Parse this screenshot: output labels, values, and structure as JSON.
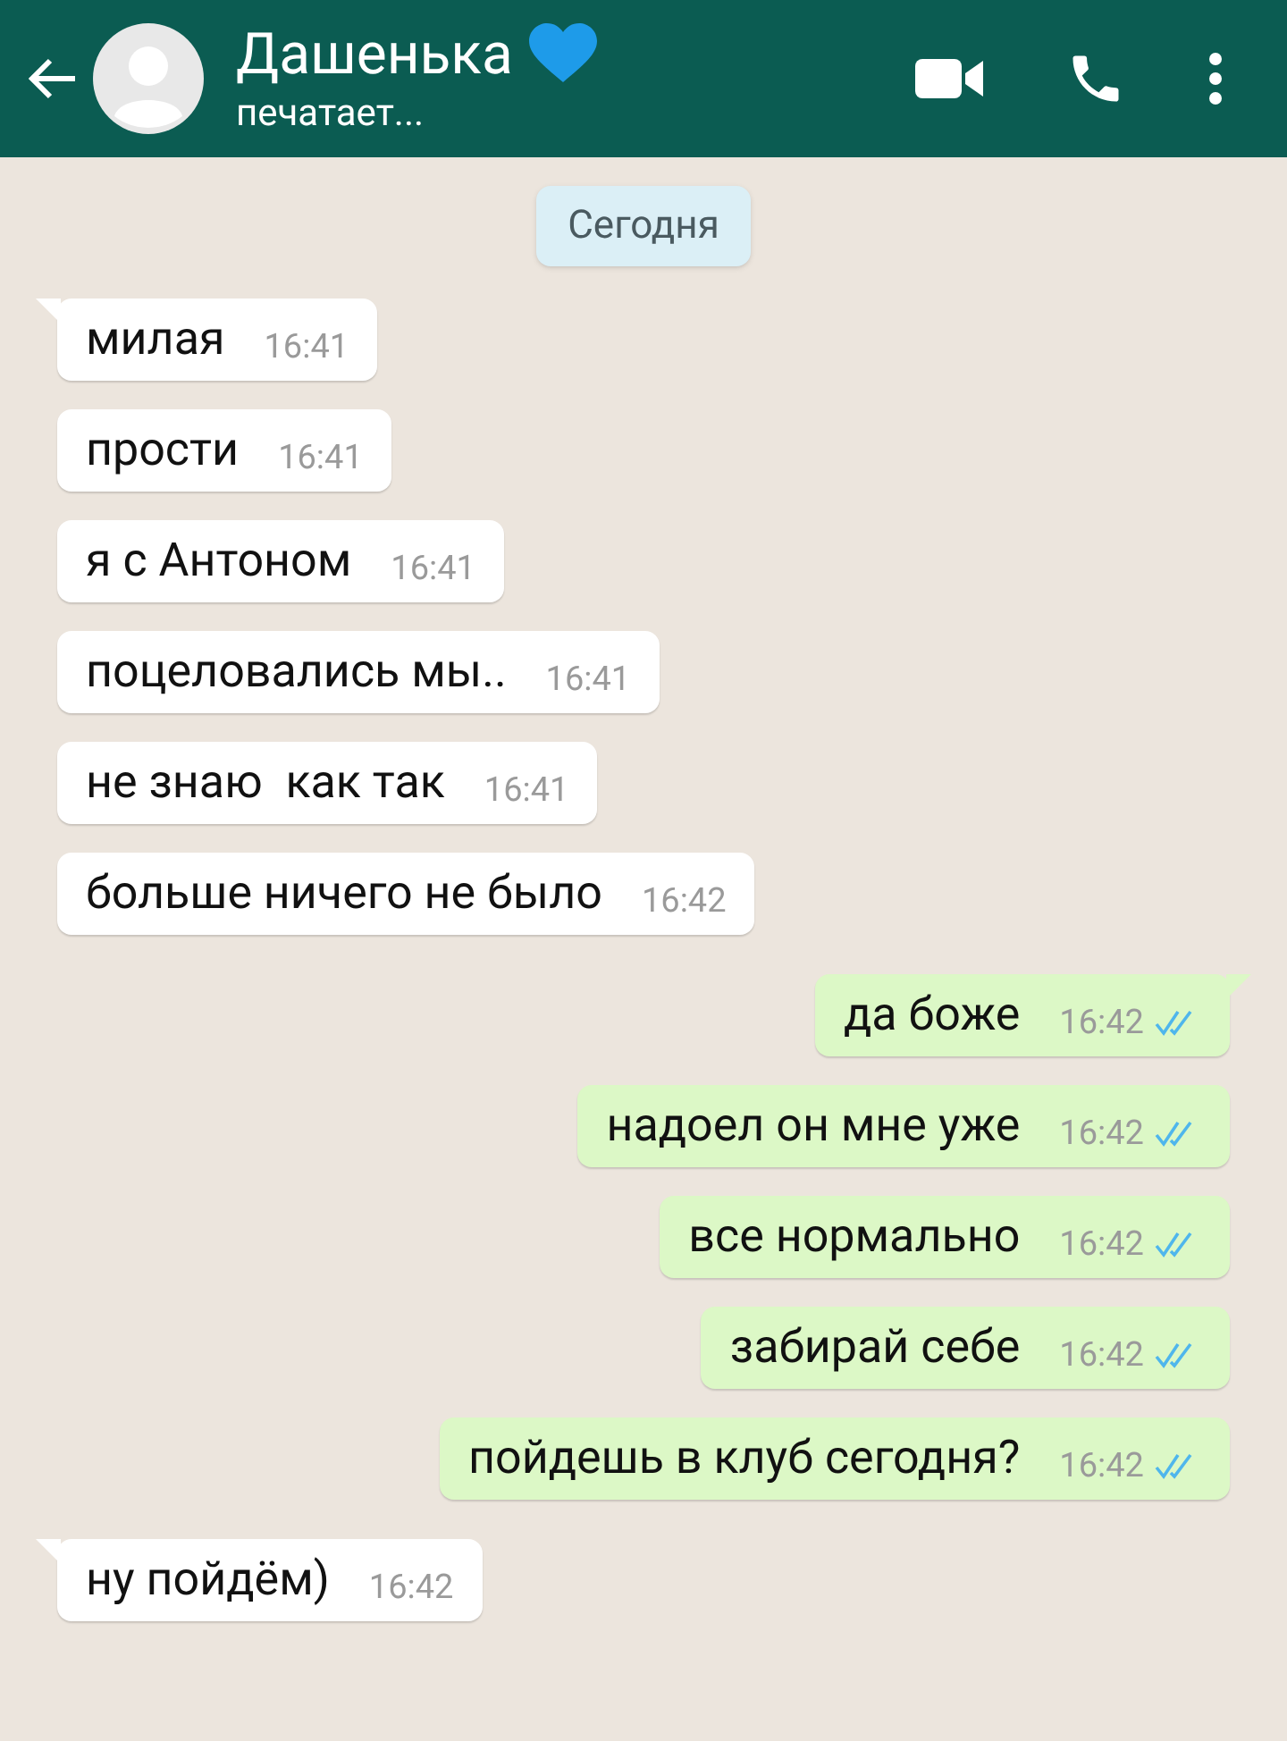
{
  "header": {
    "contact_name": "Дашенька",
    "status": "печатает..."
  },
  "date_chip": "Сегодня",
  "messages": [
    {
      "kind": "received",
      "text": "милая",
      "time": "16:41",
      "tail": true
    },
    {
      "kind": "received",
      "text": "прости",
      "time": "16:41",
      "tail": false
    },
    {
      "kind": "received",
      "text": "я с Антоном",
      "time": "16:41",
      "tail": false
    },
    {
      "kind": "received",
      "text": "поцеловались мы..",
      "time": "16:41",
      "tail": false
    },
    {
      "kind": "received",
      "text": "не знаю  как так",
      "time": "16:41",
      "tail": false
    },
    {
      "kind": "received",
      "text": "больше ничего не было",
      "time": "16:42",
      "tail": false
    },
    {
      "kind": "sent",
      "text": "да боже",
      "time": "16:42",
      "tail": true,
      "read": true
    },
    {
      "kind": "sent",
      "text": "надоел он мне уже",
      "time": "16:42",
      "tail": false,
      "read": true
    },
    {
      "kind": "sent",
      "text": "все нормально",
      "time": "16:42",
      "tail": false,
      "read": true
    },
    {
      "kind": "sent",
      "text": "забирай себе",
      "time": "16:42",
      "tail": false,
      "read": true
    },
    {
      "kind": "sent",
      "text": "пойдешь в клуб сегодня?",
      "time": "16:42",
      "tail": false,
      "read": true
    },
    {
      "kind": "received",
      "text": "ну пойдём)",
      "time": "16:42",
      "tail": true
    }
  ]
}
